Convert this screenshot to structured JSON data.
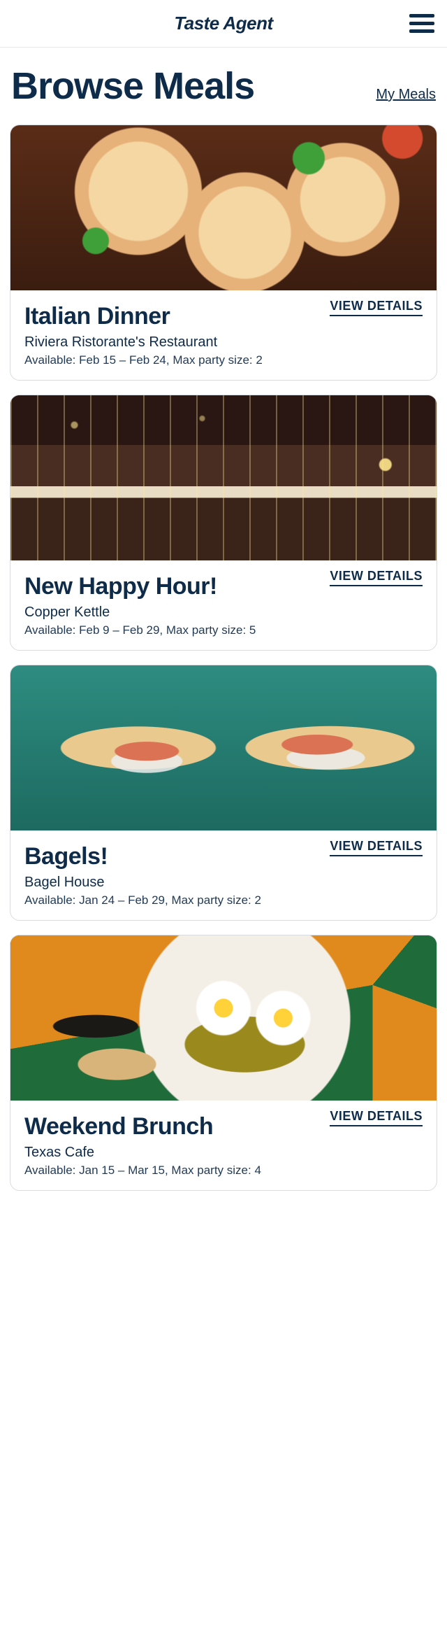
{
  "header": {
    "brand": "Taste Agent"
  },
  "title_row": {
    "page_title": "Browse Meals",
    "my_meals_link": "My Meals"
  },
  "view_details_label": "VIEW DETAILS",
  "meals": [
    {
      "title": "Italian Dinner",
      "restaurant": "Riviera Ristorante's Restaurant",
      "availability": "Available: Feb 15 – Feb 24, Max party size: 2",
      "image": "pasta"
    },
    {
      "title": "New Happy Hour!",
      "restaurant": "Copper Kettle",
      "availability": "Available: Feb 9 – Feb 29, Max party size: 5",
      "image": "bar"
    },
    {
      "title": "Bagels!",
      "restaurant": "Bagel House",
      "availability": "Available: Jan 24 – Feb 29, Max party size: 2",
      "image": "bagel"
    },
    {
      "title": "Weekend Brunch",
      "restaurant": "Texas Cafe",
      "availability": "Available: Jan 15 – Mar 15, Max party size: 4",
      "image": "brunch"
    }
  ]
}
